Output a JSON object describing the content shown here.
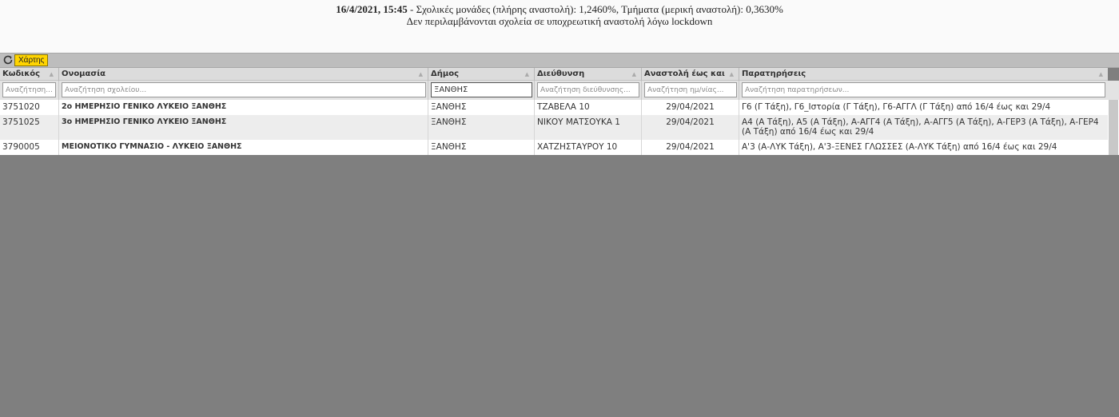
{
  "header": {
    "line1_bold": "16/4/2021, 15:45",
    "line1_rest": " - Σχολικές μονάδες (πλήρης αναστολή): 1,2460%, Τμήματα (μερική αναστολή): 0,3630%",
    "line2": "Δεν περιλαμβάνονται σχολεία σε υποχρεωτική αναστολή λόγω lockdown"
  },
  "toolbar": {
    "refresh_icon": "refresh-icon",
    "map_label": "Χάρτης",
    "map_color": "#ffd400"
  },
  "columns": [
    {
      "label": "Κωδικός",
      "placeholder": "Αναζήτηση..."
    },
    {
      "label": "Ονομασία",
      "placeholder": "Αναζήτηση σχολείου..."
    },
    {
      "label": "Δήμος",
      "placeholder": "",
      "value": "ΞΑΝΘΗΣ"
    },
    {
      "label": "Διεύθυνση",
      "placeholder": "Αναζήτηση διεύθυνσης..."
    },
    {
      "label": "Αναστολή έως και",
      "placeholder": "Αναζήτηση ημ/νίας..."
    },
    {
      "label": "Παρατηρήσεις",
      "placeholder": "Αναζήτηση παρατηρήσεων..."
    }
  ],
  "rows": [
    {
      "code": "3751020",
      "name": "2ο ΗΜΕΡΗΣΙΟ ΓΕΝΙΚΟ ΛΥΚΕΙΟ ΞΑΝΘΗΣ",
      "municipality": "ΞΑΝΘΗΣ",
      "address": "ΤΖΑΒΕΛΑ 10",
      "date": "29/04/2021",
      "notes": "Γ6 (Γ Τάξη), Γ6_Ιστορία (Γ Τάξη), Γ6-ΑΓΓΛ (Γ Τάξη) από 16/4 έως και 29/4"
    },
    {
      "code": "3751025",
      "name": "3ο ΗΜΕΡΗΣΙΟ ΓΕΝΙΚΟ ΛΥΚΕΙΟ ΞΑΝΘΗΣ",
      "municipality": "ΞΑΝΘΗΣ",
      "address": "ΝΙΚΟΥ ΜΑΤΣΟΥΚΑ 1",
      "date": "29/04/2021",
      "notes": "Α4 (Α Τάξη), Α5 (Α Τάξη), Α-ΑΓΓ4 (Α Τάξη), Α-ΑΓΓ5 (Α Τάξη), Α-ΓΕΡ3 (Α Τάξη), Α-ΓΕΡ4 (Α Τάξη) από 16/4 έως και 29/4"
    },
    {
      "code": "3790005",
      "name": "ΜΕΙΟΝΟΤΙΚΟ ΓΥΜΝΑΣΙΟ - ΛΥΚΕΙΟ  ΞΑΝΘΗΣ",
      "municipality": "ΞΑΝΘΗΣ",
      "address": "ΧΑΤΖΗΣΤΑΥΡΟΥ 10",
      "date": "29/04/2021",
      "notes": "Α'3 (Α-ΛΥΚ Τάξη), Α'3-ΞΕΝΕΣ ΓΛΩΣΣΕΣ (Α-ΛΥΚ Τάξη) από 16/4 έως και 29/4"
    }
  ]
}
